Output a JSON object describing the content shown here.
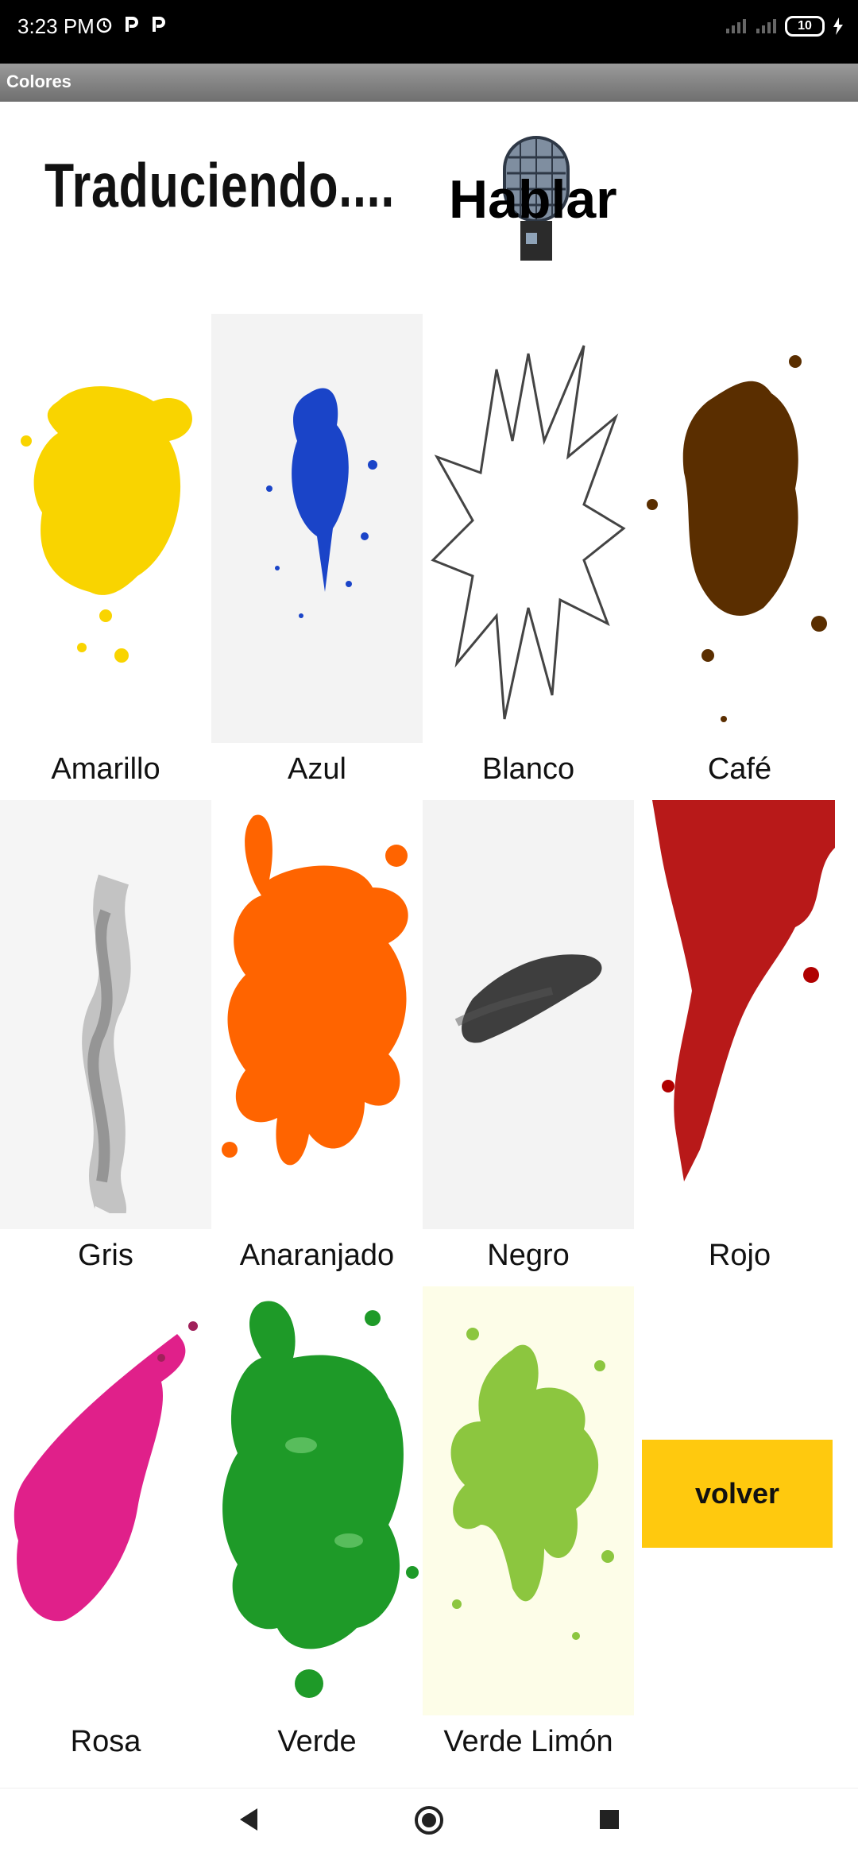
{
  "status_bar": {
    "time": "3:23 PM",
    "battery": "10"
  },
  "app": {
    "title": "Colores"
  },
  "header": {
    "translating_text": "Traduciendo....",
    "speak_label": "Hablar"
  },
  "colors": [
    {
      "label": "Amarillo",
      "hex": "#f9d400"
    },
    {
      "label": "Azul",
      "hex": "#1a44c8"
    },
    {
      "label": "Blanco",
      "hex": "#ffffff"
    },
    {
      "label": "Café",
      "hex": "#5a2e00"
    },
    {
      "label": "Gris",
      "hex": "#9a9a9a"
    },
    {
      "label": "Anaranjado",
      "hex": "#ff6400"
    },
    {
      "label": "Negro",
      "hex": "#2a2a2a"
    },
    {
      "label": "Rojo",
      "hex": "#b00000"
    },
    {
      "label": "Rosa",
      "hex": "#e0208a"
    },
    {
      "label": "Verde",
      "hex": "#1e9a28"
    },
    {
      "label": "Verde Limón",
      "hex": "#8cc63f"
    }
  ],
  "back_button": {
    "label": "volver",
    "color": "#ffc90e"
  },
  "nav": {
    "back_icon": "triangle-back-icon",
    "home_icon": "circle-home-icon",
    "recents_icon": "square-recents-icon"
  }
}
